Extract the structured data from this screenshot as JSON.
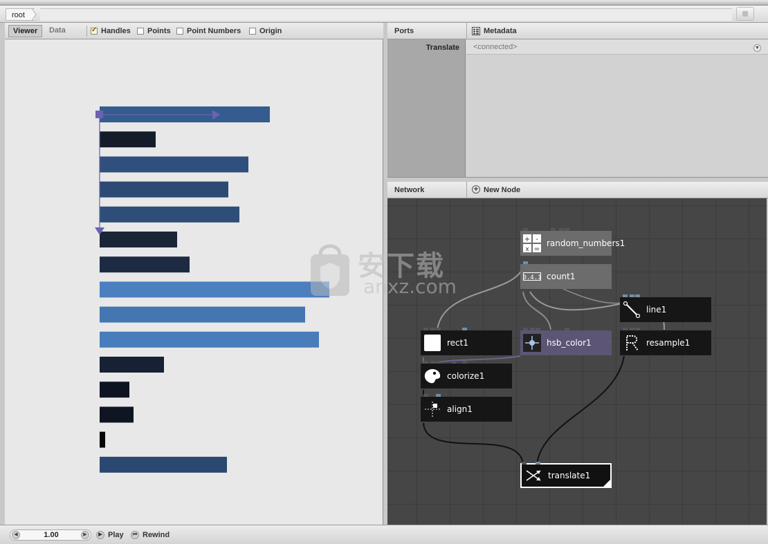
{
  "breadcrumb": {
    "root": "root"
  },
  "viewer": {
    "tabs": [
      "Viewer",
      "Data"
    ],
    "options": [
      {
        "label": "Handles",
        "checked": true
      },
      {
        "label": "Points",
        "checked": false
      },
      {
        "label": "Point Numbers",
        "checked": false
      },
      {
        "label": "Origin",
        "checked": false
      }
    ],
    "bars": [
      {
        "value": 246,
        "color": "#345c8e"
      },
      {
        "value": 81,
        "color": "#141c2a"
      },
      {
        "value": 215,
        "color": "#2f4f7c"
      },
      {
        "value": 186,
        "color": "#2c4a74"
      },
      {
        "value": 202,
        "color": "#2e4d78"
      },
      {
        "value": 112,
        "color": "#1a2538"
      },
      {
        "value": 130,
        "color": "#1d2b42"
      },
      {
        "value": 332,
        "color": "#4b7fbf"
      },
      {
        "value": 297,
        "color": "#4576b1"
      },
      {
        "value": 317,
        "color": "#497cba"
      },
      {
        "value": 93,
        "color": "#172134"
      },
      {
        "value": 43,
        "color": "#0d1320"
      },
      {
        "value": 49,
        "color": "#0f1522"
      },
      {
        "value": 8,
        "color": "#05070b"
      },
      {
        "value": 184,
        "color": "#2b4870"
      }
    ]
  },
  "ports": {
    "header": "Ports",
    "metadata": "Metadata",
    "rows": [
      {
        "name": "Translate",
        "value": "<connected>"
      }
    ]
  },
  "network": {
    "header": "Network",
    "new_node": "New Node",
    "nodes": {
      "random_numbers1": "random_numbers1",
      "count1": "count1",
      "line1": "line1",
      "rect1": "rect1",
      "hsb_color1": "hsb_color1",
      "resample1": "resample1",
      "colorize1": "colorize1",
      "align1": "align1",
      "translate1": "translate1"
    },
    "icons": {
      "random_numbers1": "calculator-icon",
      "count1": "counter-icon",
      "line1": "line-icon",
      "rect1": "rectangle-icon",
      "hsb_color1": "color-picker-icon",
      "resample1": "resample-icon",
      "colorize1": "palette-icon",
      "align1": "align-icon",
      "translate1": "translate-icon"
    }
  },
  "watermark": {
    "text": "安下载",
    "sub": "anxz.com"
  },
  "statusbar": {
    "zoom": "1.00",
    "play": "Play",
    "rewind": "Rewind"
  }
}
